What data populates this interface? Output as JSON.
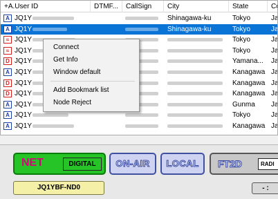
{
  "list": {
    "headers": [
      "+A.User ID",
      "DTMF...",
      "CallSign",
      "City",
      "State",
      "Co"
    ],
    "rows": [
      {
        "icon": "A",
        "icon_color": "#1d3fa8",
        "user_id": "JQ1Y",
        "city": "Shinagawa-ku",
        "state": "Tokyo",
        "co": "Ja",
        "selected": false
      },
      {
        "icon": "A",
        "icon_color": "#1d3fa8",
        "user_id": "JQ1Y",
        "city": "Shinagawa-ku",
        "state": "Tokyo",
        "co": "Ja",
        "selected": true
      },
      {
        "icon": "wifi",
        "icon_color": "#d81b1b",
        "user_id": "JQ1Y",
        "city": "",
        "state": "Tokyo",
        "co": "Ja",
        "selected": false
      },
      {
        "icon": "wifi",
        "icon_color": "#d81b1b",
        "user_id": "JQ1Y",
        "city": "",
        "state": "Tokyo",
        "co": "Ja",
        "selected": false
      },
      {
        "icon": "D",
        "icon_color": "#d81b1b",
        "user_id": "JQ1Y",
        "city": "",
        "state": "Yamana...",
        "co": "Ja",
        "selected": false
      },
      {
        "icon": "A",
        "icon_color": "#1d3fa8",
        "user_id": "JQ1Y",
        "city": "",
        "state": "Kanagawa",
        "co": "Ja",
        "selected": false
      },
      {
        "icon": "D",
        "icon_color": "#d81b1b",
        "user_id": "JQ1Y",
        "city": "",
        "state": "Kanagawa",
        "co": "Ja",
        "selected": false
      },
      {
        "icon": "D",
        "icon_color": "#d81b1b",
        "user_id": "JQ1Y",
        "city": "",
        "state": "Kanagawa",
        "co": "Ja",
        "selected": false
      },
      {
        "icon": "A",
        "icon_color": "#1d3fa8",
        "user_id": "JQ1Y",
        "city": "",
        "state": "Gunma",
        "co": "Ja",
        "selected": false
      },
      {
        "icon": "A",
        "icon_color": "#1d3fa8",
        "user_id": "JQ1Y",
        "city": "",
        "state": "Tokyo",
        "co": "Ja",
        "selected": false
      },
      {
        "icon": "A",
        "icon_color": "#1d3fa8",
        "user_id": "JQ1Y",
        "city": "",
        "state": "Kanagawa",
        "co": "Ja",
        "selected": false
      }
    ]
  },
  "context_menu": {
    "items": [
      "Connect",
      "Get Info",
      "Window default",
      "Add Bookmark list",
      "Node Reject"
    ]
  },
  "panel": {
    "net_label": "NET",
    "digital_label": "DIGITAL",
    "onair_label": "ON-AIR",
    "local_label": "LOCAL",
    "ft2d_label": "FT2D",
    "radio_label": "RADI",
    "callsign_node": "JQ1YBF-ND0",
    "small_button": "- :"
  }
}
